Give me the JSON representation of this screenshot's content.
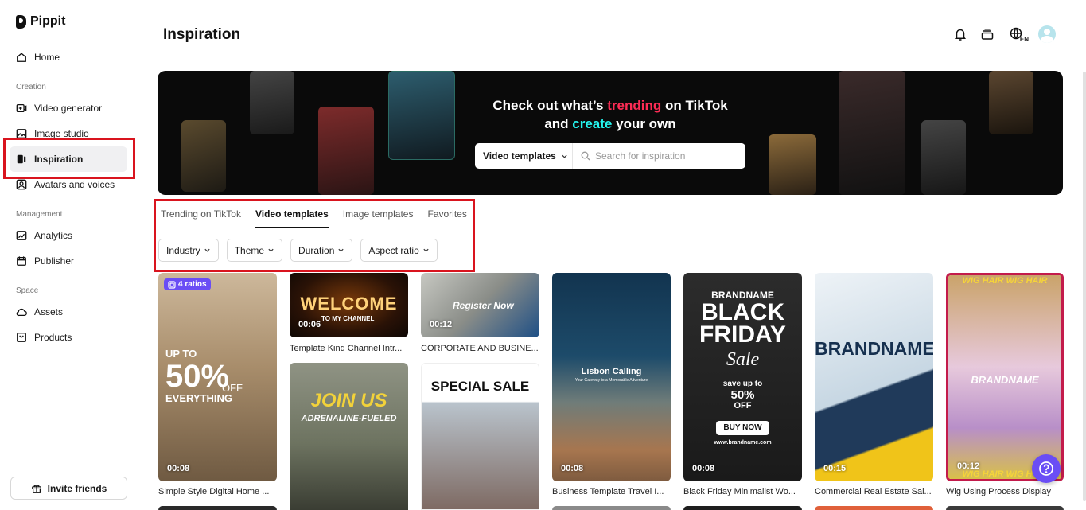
{
  "app": {
    "name": "Pippit"
  },
  "sidebar": {
    "home": "Home",
    "section_creation": "Creation",
    "creation_items": [
      "Video generator",
      "Image studio",
      "Inspiration",
      "Avatars and voices"
    ],
    "section_management": "Management",
    "management_items": [
      "Analytics",
      "Publisher"
    ],
    "section_space": "Space",
    "space_items": [
      "Assets",
      "Products"
    ],
    "active_item": "Inspiration",
    "invite": "Invite friends"
  },
  "header": {
    "title": "Inspiration",
    "icons": [
      "bell-icon",
      "cards-icon",
      "globe-icon",
      "avatar"
    ],
    "lang": "EN"
  },
  "banner": {
    "headline_part1": "Check out what’s ",
    "headline_trending": "trending",
    "headline_part2": " on TikTok",
    "headline_part3": "and ",
    "headline_create": "create",
    "headline_part4": " your own",
    "select_label": "Video templates",
    "search_placeholder": "Search for inspiration",
    "colors": {
      "pink": "#fe2c55",
      "cyan": "#25f4ee"
    }
  },
  "tabs": [
    {
      "label": "Trending on TikTok",
      "active": false
    },
    {
      "label": "Video templates",
      "active": true
    },
    {
      "label": "Image templates",
      "active": false
    },
    {
      "label": "Favorites",
      "active": false
    }
  ],
  "filters": [
    "Industry",
    "Theme",
    "Duration",
    "Aspect ratio"
  ],
  "cards": [
    {
      "title": "Simple Style Digital Home ...",
      "duration": "00:08",
      "badge": "4 ratios",
      "overlay": [
        "UP TO",
        "50%",
        "OFF",
        "EVERYTHING"
      ]
    },
    {
      "title": "Template Kind Channel Intr...",
      "duration": "00:06",
      "overlay": [
        "WELCOME",
        "TO MY CHANNEL"
      ]
    },
    {
      "title": "",
      "duration": "",
      "overlay": [
        "JOIN US",
        "ADRENALINE-FUELED"
      ]
    },
    {
      "title": "CORPORATE AND BUSINE...",
      "duration": "00:12",
      "overlay": [
        "Register Now"
      ]
    },
    {
      "title": "",
      "duration": "",
      "overlay": [
        "SPECIAL SALE"
      ]
    },
    {
      "title": "Business Template Travel I...",
      "duration": "00:08",
      "overlay": [
        "Lisbon Calling",
        "Your Gateway to a Memorable Adventure"
      ]
    },
    {
      "title": "Black Friday Minimalist Wo...",
      "duration": "00:08",
      "overlay": [
        "BRANDNAME",
        "BLACK",
        "FRIDAY",
        "Sale",
        "save up to",
        "50%",
        "OFF",
        "BUY NOW",
        "www.brandname.com"
      ]
    },
    {
      "title": "Commercial Real Estate Sal...",
      "duration": "00:15",
      "overlay": [
        "BRANDNAME"
      ]
    },
    {
      "title": "Wig Using Process Display",
      "duration": "00:12",
      "overlay": [
        "WIG HAIR WIG HAIR",
        "BRANDNAME",
        "WIG HAIR WIG HAIR"
      ]
    }
  ],
  "highlight_color": "#d9141e",
  "accent": "#6a4df5"
}
